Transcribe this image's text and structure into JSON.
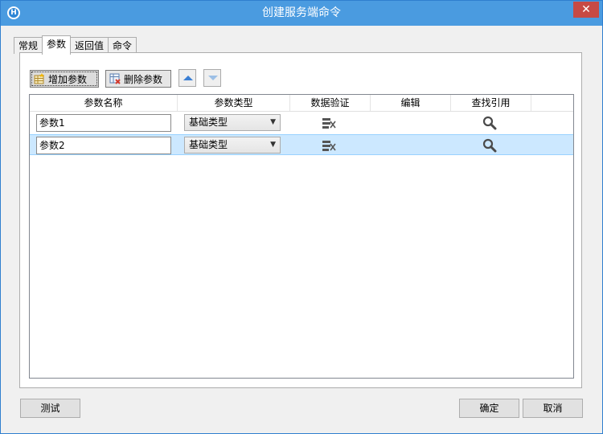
{
  "window": {
    "title": "创建服务端命令",
    "app_icon_letter": "H",
    "close_glyph": "✕",
    "titlebar_color": "#4a9be0",
    "close_color": "#c74a44"
  },
  "tabs": [
    {
      "label": "常规",
      "active": false
    },
    {
      "label": "参数",
      "active": true
    },
    {
      "label": "返回值",
      "active": false
    },
    {
      "label": "命令",
      "active": false
    }
  ],
  "toolbar": {
    "add_label": "增加参数",
    "delete_label": "删除参数",
    "add_icon": "add-table-icon",
    "delete_icon": "delete-table-icon",
    "move_up_icon": "arrow-up-icon",
    "move_down_icon": "arrow-down-icon"
  },
  "grid": {
    "columns": [
      "参数名称",
      "参数类型",
      "数据验证",
      "编辑",
      "查找引用"
    ],
    "rows": [
      {
        "name": "参数1",
        "type": "基础类型",
        "selected": false
      },
      {
        "name": "参数2",
        "type": "基础类型",
        "selected": true
      }
    ],
    "selected_row_color": "#cce8ff"
  },
  "footer": {
    "test_label": "测试",
    "ok_label": "确定",
    "cancel_label": "取消"
  }
}
